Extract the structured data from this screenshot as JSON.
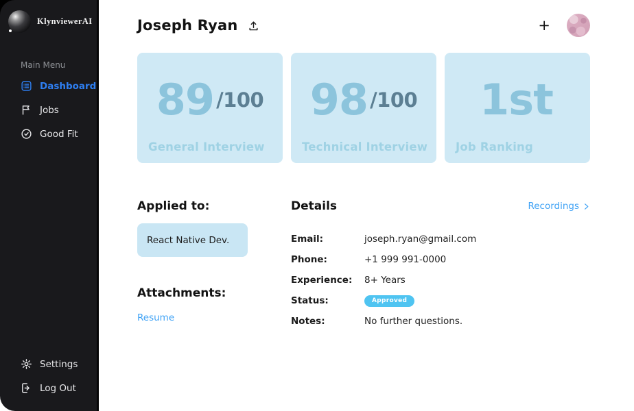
{
  "app": {
    "name": "KlynviewerAI"
  },
  "sidebar": {
    "section_label": "Main Menu",
    "items": [
      {
        "label": "Dashboard",
        "icon": "dashboard-list-icon",
        "active": true
      },
      {
        "label": "Jobs",
        "icon": "flag-icon",
        "active": false
      },
      {
        "label": "Good Fit",
        "icon": "check-circle-icon",
        "active": false
      }
    ],
    "footer_items": [
      {
        "label": "Settings",
        "icon": "gear-icon"
      },
      {
        "label": "Log Out",
        "icon": "logout-icon"
      }
    ]
  },
  "header": {
    "title": "Joseph Ryan",
    "upload_icon": "upload-icon",
    "add_label": "+",
    "avatar_icon": "avatar"
  },
  "score_cards": [
    {
      "value": "89",
      "suffix": "/100",
      "label": "General Interview"
    },
    {
      "value": "98",
      "suffix": "/100",
      "label": "Technical Interview"
    },
    {
      "value": "1st",
      "suffix": "",
      "label": "Job Ranking"
    }
  ],
  "applied_to": {
    "heading": "Applied to:",
    "job": "React Native Dev."
  },
  "attachments": {
    "heading": "Attachments:",
    "link": "Resume"
  },
  "details": {
    "heading": "Details",
    "recordings_label": "Recordings",
    "email_label": "Email:",
    "email_value": "joseph.ryan@gmail.com",
    "phone_label": "Phone:",
    "phone_value": "+1 999 991-0000",
    "experience_label": "Experience:",
    "experience_value": "8+ Years",
    "status_label": "Status:",
    "status_value": "Approved",
    "notes_label": "Notes:",
    "notes_value": "No further questions."
  },
  "colors": {
    "sidebar_bg": "#19191c",
    "active_blue": "#2e7ff2",
    "link_blue": "#3fa2f5",
    "badge_blue": "#4fc4f1",
    "card_bg": "#cfe9f5",
    "card_number": "#8cc4dc",
    "card_suffix": "#5c7f93",
    "card_label": "#9fd2e4"
  }
}
